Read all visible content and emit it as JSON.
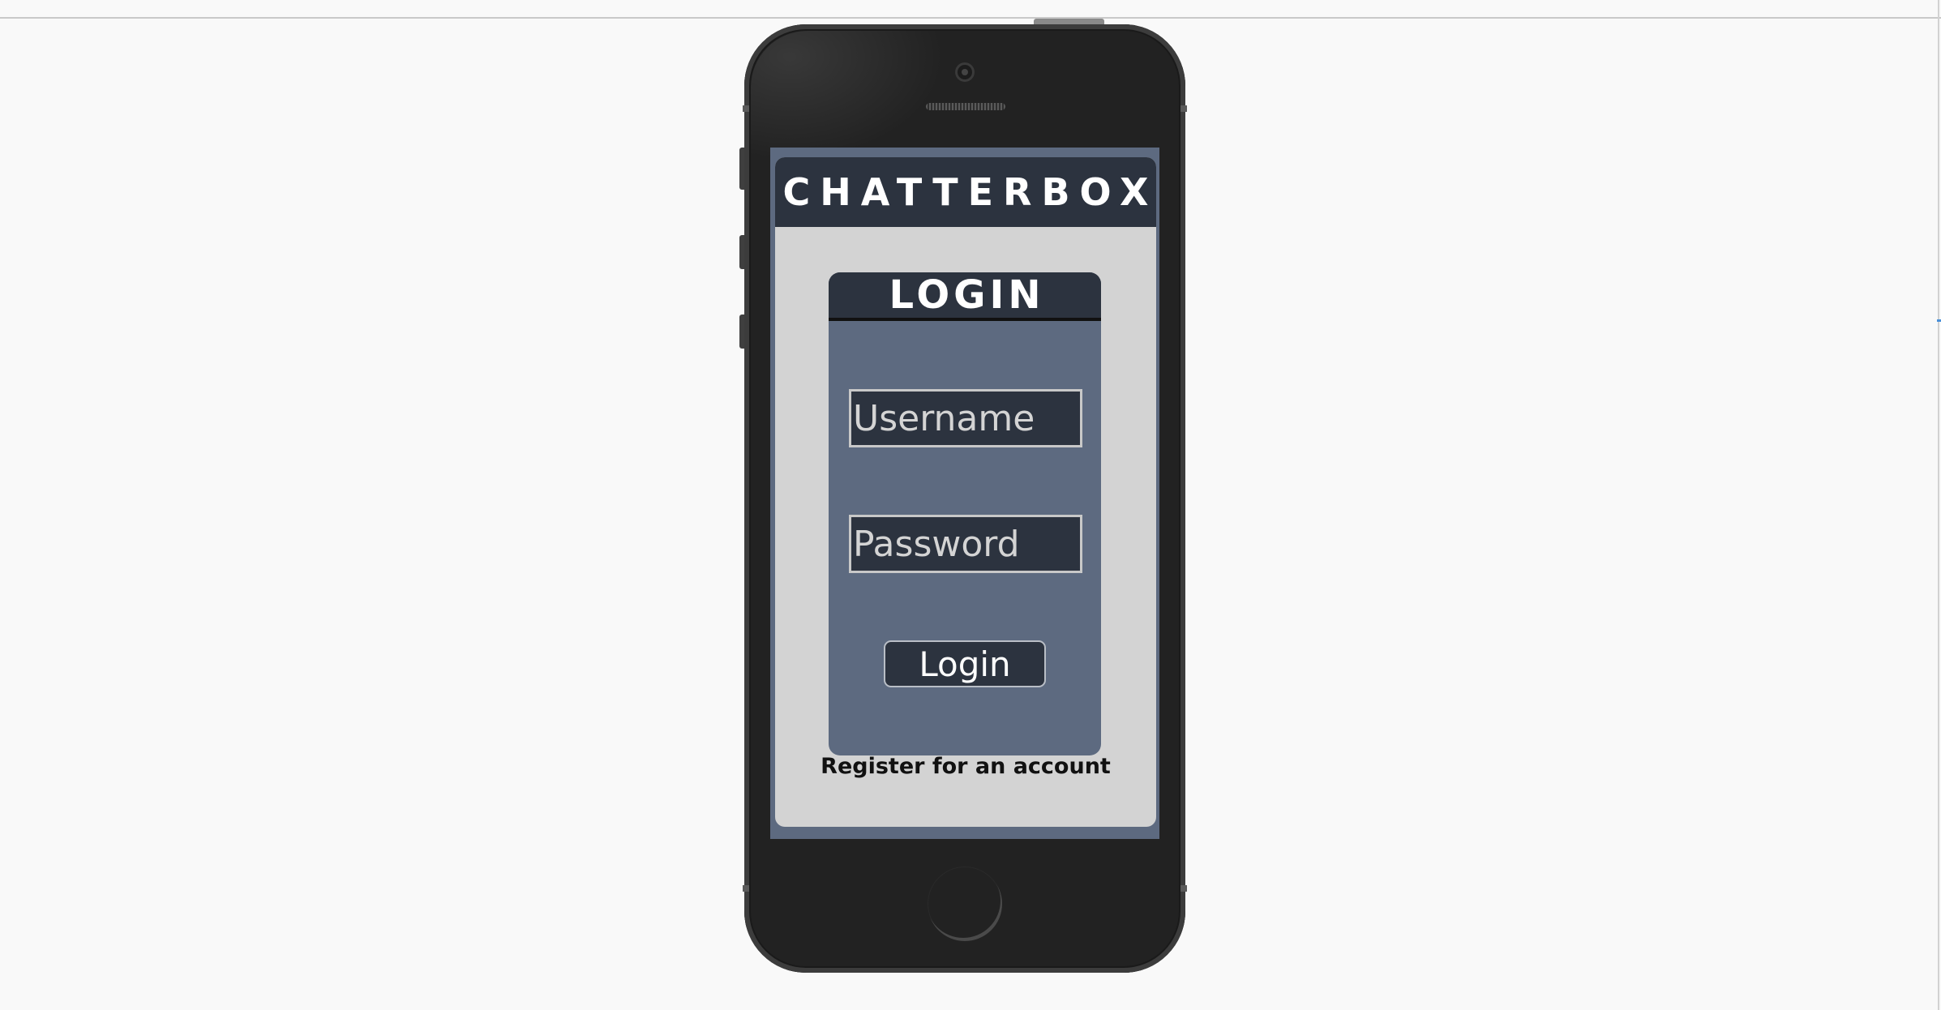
{
  "app": {
    "title": "CHATTERBOX"
  },
  "login": {
    "heading": "LOGIN",
    "username_placeholder": "Username",
    "password_placeholder": "Password",
    "submit_label": "Login",
    "register_label": "Register for an account"
  },
  "colors": {
    "page_background": "#f9f9f9",
    "phone_body": "#222222",
    "screen_accent": "#5d6a80",
    "header_dark": "#2c333f",
    "card_background": "#d3d3d3",
    "text_light": "#ffffff",
    "placeholder_text": "#d4d4d4"
  },
  "icons": {
    "camera": "camera-icon",
    "speaker": "speaker-grille-icon",
    "home": "home-button-icon"
  }
}
